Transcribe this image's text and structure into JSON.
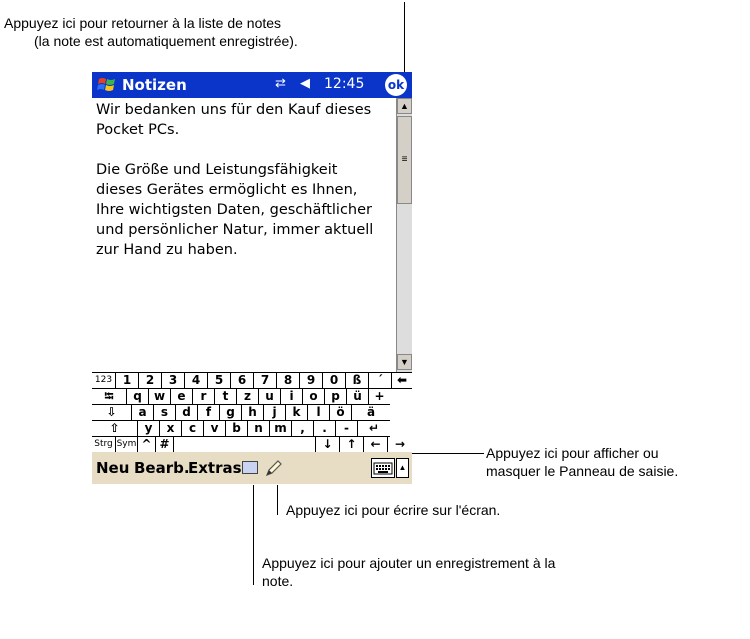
{
  "callouts": {
    "ok_line1": "Appuyez ici pour retourner à la liste de notes",
    "ok_line2": "(la note est automatiquement enregistrée).",
    "input_panel_line1": "Appuyez ici pour afficher ou",
    "input_panel_line2": "masquer le Panneau de saisie.",
    "write": "Appuyez ici pour écrire sur l'écran.",
    "record_line1": "Appuyez ici pour ajouter un enregistrement à la",
    "record_line2": "note."
  },
  "titlebar": {
    "title": "Notizen",
    "connectivity": "⇄",
    "volume": "◀",
    "time": "12:45",
    "ok": "ok",
    "start_icon": "windows-flag-icon"
  },
  "note": {
    "paragraph1": "Wir bedanken uns für den Kauf dieses\nPocket PCs.",
    "paragraph2": "Die Größe und Leistungsfähigkeit\ndieses Gerätes ermöglicht es Ihnen,\nIhre wichtigsten Daten, geschäftlicher\nund persönlicher Natur, immer aktuell\nzur Hand zu haben."
  },
  "scrollbar": {
    "up": "▲",
    "thumb": "≡",
    "down": "▼"
  },
  "keyboard": {
    "row1": [
      "123",
      "1",
      "2",
      "3",
      "4",
      "5",
      "6",
      "7",
      "8",
      "9",
      "0",
      "ß",
      "´",
      "⬅"
    ],
    "row2": [
      "⭾",
      "q",
      "w",
      "e",
      "r",
      "t",
      "z",
      "u",
      "i",
      "o",
      "p",
      "ü",
      "+"
    ],
    "row3": [
      "⇩",
      "a",
      "s",
      "d",
      "f",
      "g",
      "h",
      "j",
      "k",
      "l",
      "ö",
      "ä"
    ],
    "row4": [
      "⇧",
      "y",
      "x",
      "c",
      "v",
      "b",
      "n",
      "m",
      ",",
      ".",
      "-",
      "↵"
    ],
    "row5": [
      "Strg",
      "Sym",
      "^",
      "#",
      " ",
      "↓",
      "↑",
      "←",
      "→"
    ]
  },
  "menubar": {
    "neu": "Neu",
    "bearb": "Bearb.",
    "extras": "Extras",
    "record_icon": "recording-icon",
    "pen_icon": "pen-icon",
    "keyboard_icon": "keyboard-icon",
    "input_arrow": "▲"
  },
  "colors": {
    "titlebar": "#0a35c8",
    "menubar": "#e6ddc4"
  }
}
